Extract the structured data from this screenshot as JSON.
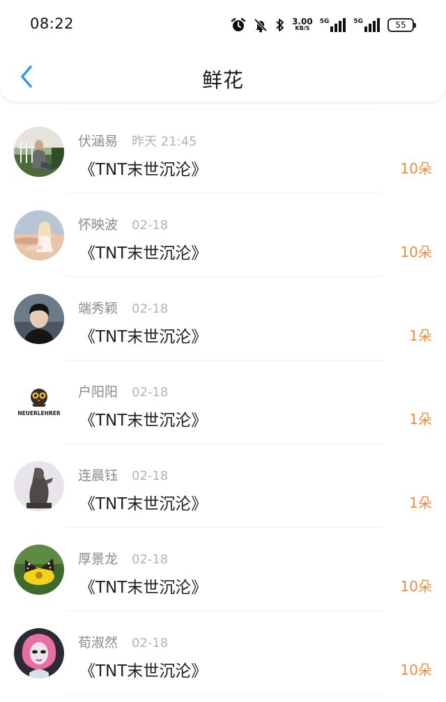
{
  "status_bar": {
    "time": "08:22",
    "net_speed_value": "3.00",
    "net_speed_unit": "KB/S",
    "signal_1_label": "5G",
    "signal_2_label": "5G",
    "battery": "55",
    "icons": [
      "alarm-icon",
      "bell-muted-icon",
      "bluetooth-icon",
      "signal-icon",
      "battery-icon"
    ]
  },
  "nav": {
    "title": "鲜花",
    "back_icon": "chevron-left-icon",
    "accent_color": "#2e9bf0"
  },
  "flower_color": "#f08a3c",
  "items": [
    {
      "name": "伏涵易",
      "time": "昨天 21:45",
      "book": "《TNT末世沉沦》",
      "count": "10朵"
    },
    {
      "name": "怀映波",
      "time": "02-18",
      "book": "《TNT末世沉沦》",
      "count": "10朵"
    },
    {
      "name": "端秀颖",
      "time": "02-18",
      "book": "《TNT末世沉沦》",
      "count": "1朵"
    },
    {
      "name": "户阳阳",
      "time": "02-18",
      "book": "《TNT末世沉沦》",
      "count": "1朵",
      "avatar_text": "NEUERLEHRER"
    },
    {
      "name": "连晨钰",
      "time": "02-18",
      "book": "《TNT末世沉沦》",
      "count": "1朵"
    },
    {
      "name": "厚景龙",
      "time": "02-18",
      "book": "《TNT末世沉沦》",
      "count": "10朵"
    },
    {
      "name": "荀淑然",
      "time": "02-18",
      "book": "《TNT末世沉沦》",
      "count": "10朵"
    }
  ]
}
